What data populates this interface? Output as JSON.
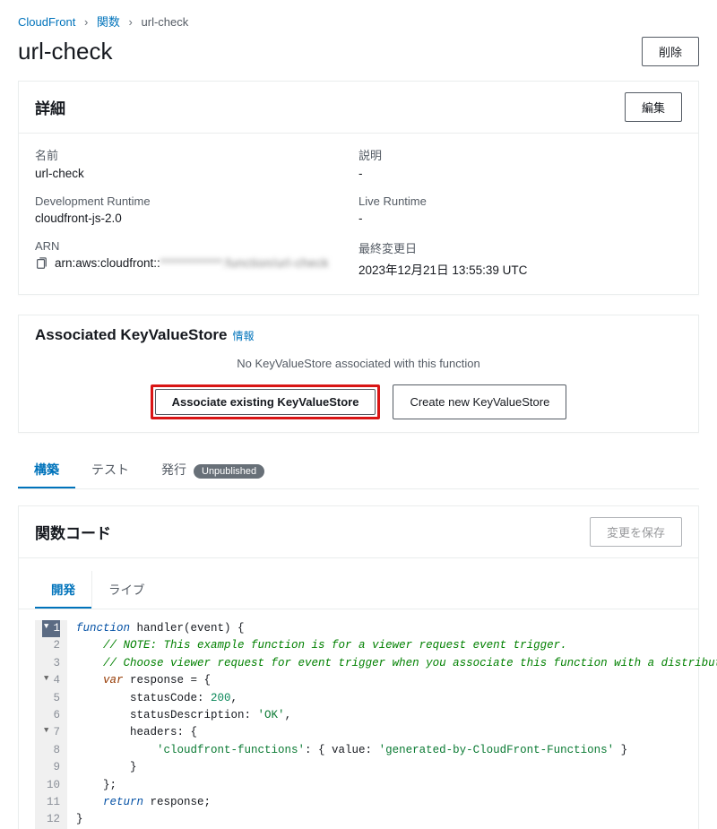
{
  "breadcrumb": {
    "items": [
      "CloudFront",
      "関数",
      "url-check"
    ]
  },
  "page": {
    "title": "url-check",
    "delete_btn": "削除"
  },
  "details": {
    "heading": "詳細",
    "edit_btn": "編集",
    "name_label": "名前",
    "name_value": "url-check",
    "runtime_label": "Development Runtime",
    "runtime_value": "cloudfront-js-2.0",
    "arn_label": "ARN",
    "arn_prefix": "arn:aws:cloudfront::",
    "arn_hidden": "************:function/url-check",
    "desc_label": "説明",
    "desc_value": "-",
    "live_label": "Live Runtime",
    "live_value": "-",
    "updated_label": "最終変更日",
    "updated_value": "2023年12月21日 13:55:39 UTC"
  },
  "kvs": {
    "heading": "Associated KeyValueStore",
    "info": "情報",
    "empty_msg": "No KeyValueStore associated with this function",
    "associate_btn": "Associate existing KeyValueStore",
    "create_btn": "Create new KeyValueStore"
  },
  "tabs": {
    "build": "構築",
    "test": "テスト",
    "publish": "発行",
    "badge": "Unpublished"
  },
  "code_section": {
    "heading": "関数コード",
    "save_btn": "変更を保存",
    "sub_dev": "開発",
    "sub_live": "ライブ"
  },
  "editor": {
    "lines": [
      {
        "n": 1,
        "fold": true,
        "active": true,
        "html": "<span class='tok-kw'>function</span> <span class='tok-fn'>handler</span>(event) {"
      },
      {
        "n": 2,
        "html": "    <span class='tok-comment'>// NOTE: This example function is for a viewer request event trigger.</span>"
      },
      {
        "n": 3,
        "html": "    <span class='tok-comment'>// Choose viewer request for event trigger when you associate this function with a distribution.</span>"
      },
      {
        "n": 4,
        "fold": true,
        "html": "    <span class='tok-kw2'>var</span> response = {"
      },
      {
        "n": 5,
        "html": "        statusCode: <span class='tok-num'>200</span>,"
      },
      {
        "n": 6,
        "html": "        statusDescription: <span class='tok-str'>'OK'</span>,"
      },
      {
        "n": 7,
        "fold": true,
        "html": "        headers: {"
      },
      {
        "n": 8,
        "html": "            <span class='tok-str'>'cloudfront-functions'</span>: { value: <span class='tok-str'>'generated-by-CloudFront-Functions'</span> }"
      },
      {
        "n": 9,
        "html": "        }"
      },
      {
        "n": 10,
        "html": "    };"
      },
      {
        "n": 11,
        "html": "    <span class='tok-kw'>return</span> response;"
      },
      {
        "n": 12,
        "html": "}"
      }
    ]
  }
}
